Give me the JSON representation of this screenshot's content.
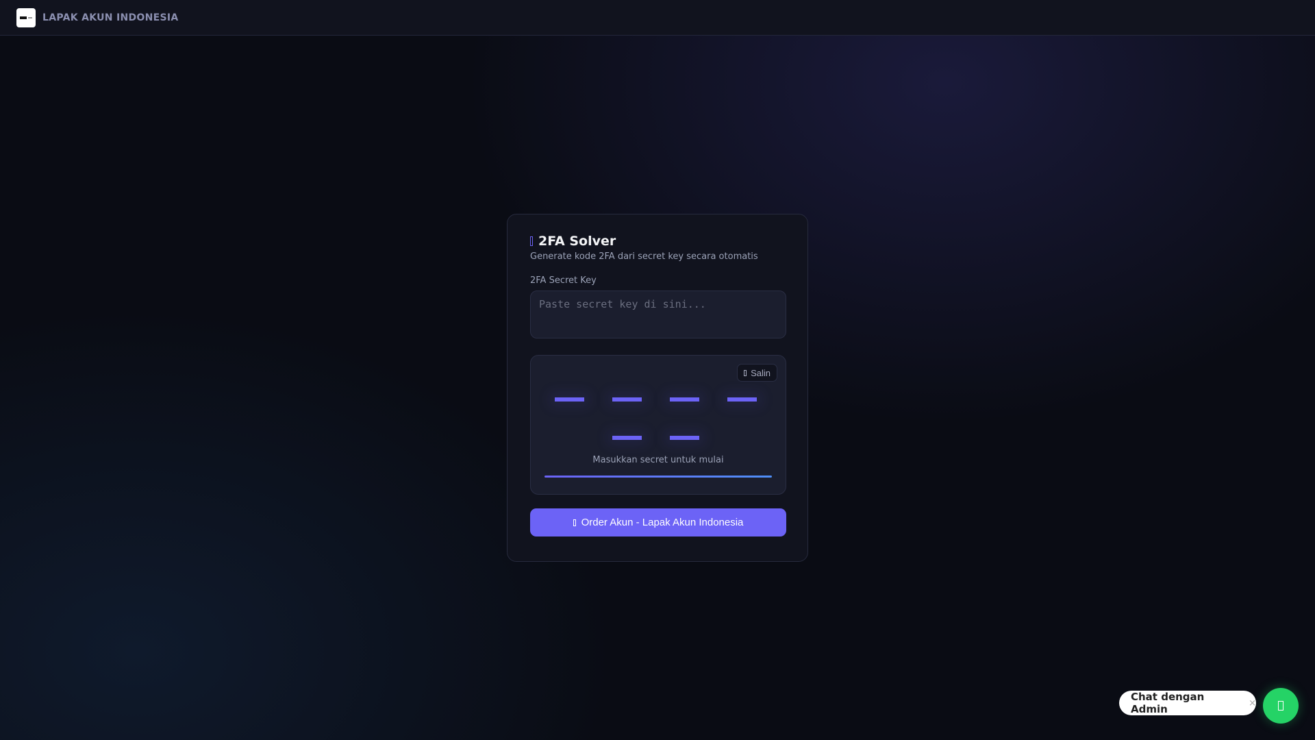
{
  "header": {
    "brand": "LAPAK AKUN INDONESIA"
  },
  "solver": {
    "title": "2FA Solver",
    "subtitle": "Generate kode 2FA dari secret key secara otomatis",
    "secret_label": "2FA Secret Key",
    "secret_value": "",
    "secret_placeholder": "Paste secret key di sini...",
    "copy_label": "Salin",
    "digits": [
      "",
      "",
      "",
      "",
      "",
      ""
    ],
    "status": "Masukkan secret untuk mulai",
    "progress_percent": 100,
    "order_label": "Order Akun - Lapak Akun Indonesia"
  },
  "chat": {
    "label": "Chat dengan Admin",
    "close": "×"
  },
  "colors": {
    "accent": "#6c63f6",
    "whatsapp": "#25d366"
  }
}
